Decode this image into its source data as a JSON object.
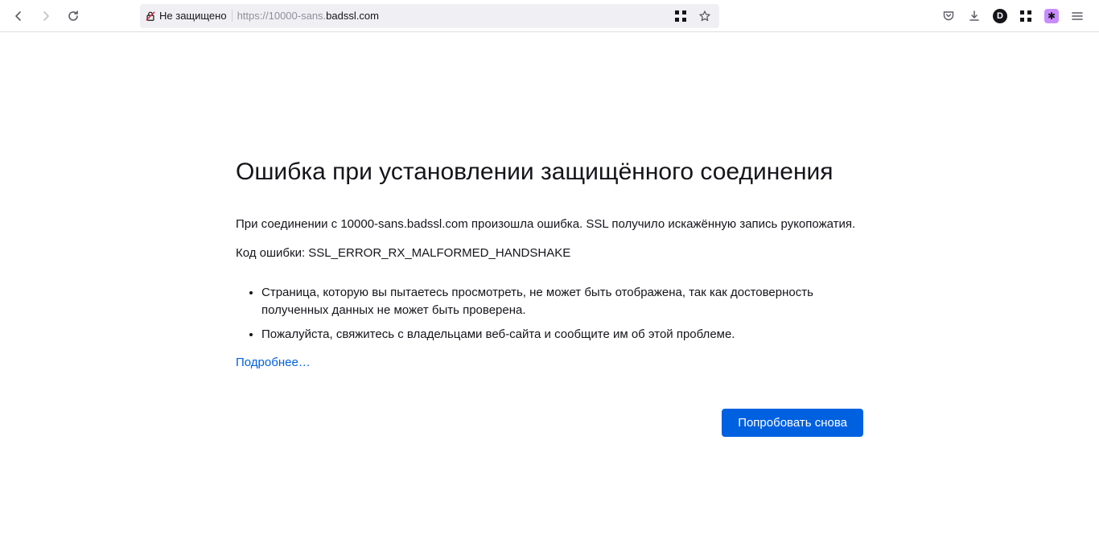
{
  "toolbar": {
    "security_label": "Не защищено",
    "url_scheme": "https://",
    "url_prefix": "10000-sans.",
    "url_host": "badssl.com"
  },
  "error": {
    "title": "Ошибка при установлении защищённого соединения",
    "p1": "При соединении с 10000-sans.badssl.com произошла ошибка. SSL получило искажённую запись рукопожатия.",
    "p2": "Код ошибки: SSL_ERROR_RX_MALFORMED_HANDSHAKE",
    "li1": "Страница, которую вы пытаетесь просмотреть, не может быть отображена, так как достоверность полученных данных не может быть проверена.",
    "li2": "Пожалуйста, свяжитесь с владельцами веб-сайта и сообщите им об этой проблеме.",
    "more": "Подробнее…",
    "retry": "Попробовать снова"
  }
}
